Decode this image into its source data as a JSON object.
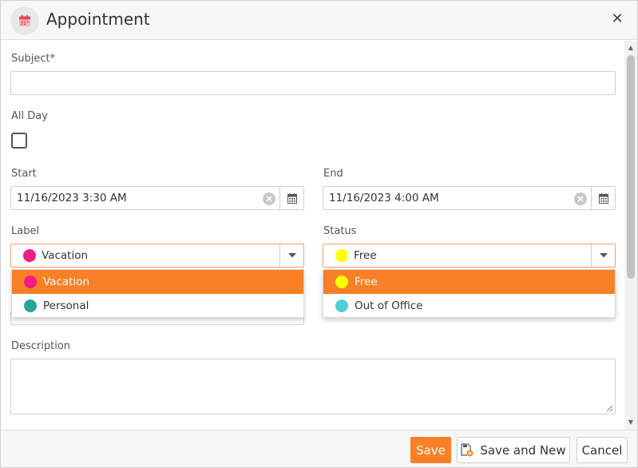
{
  "header": {
    "title": "Appointment",
    "icon": "calendar-icon",
    "close_icon": "close-icon"
  },
  "form": {
    "subject": {
      "label": "Subject*",
      "value": ""
    },
    "all_day": {
      "label": "All Day",
      "checked": false
    },
    "start": {
      "label": "Start",
      "value": "11/16/2023 3:30 AM"
    },
    "end": {
      "label": "End",
      "value": "11/16/2023 4:00 AM"
    },
    "label_field": {
      "label": "Label",
      "selected": "Vacation",
      "options": [
        {
          "text": "Vacation",
          "color": "#ee1c84",
          "selected": true
        },
        {
          "text": "Personal",
          "color": "#26a69a",
          "selected": false
        }
      ]
    },
    "status_field": {
      "label": "Status",
      "selected": "Free",
      "options": [
        {
          "text": "Free",
          "color": "#ffff00",
          "selected": true
        },
        {
          "text": "Out of Office",
          "color": "#4dd0cf",
          "selected": false
        }
      ]
    },
    "description": {
      "label": "Description",
      "value": ""
    }
  },
  "footer": {
    "save_label": "Save",
    "save_new_label": "Save and New",
    "cancel_label": "Cancel"
  },
  "colors": {
    "accent": "#f98026",
    "vacation": "#ee1c84",
    "personal": "#26a69a",
    "free": "#ffff00",
    "out_of_office": "#4dd0cf"
  }
}
